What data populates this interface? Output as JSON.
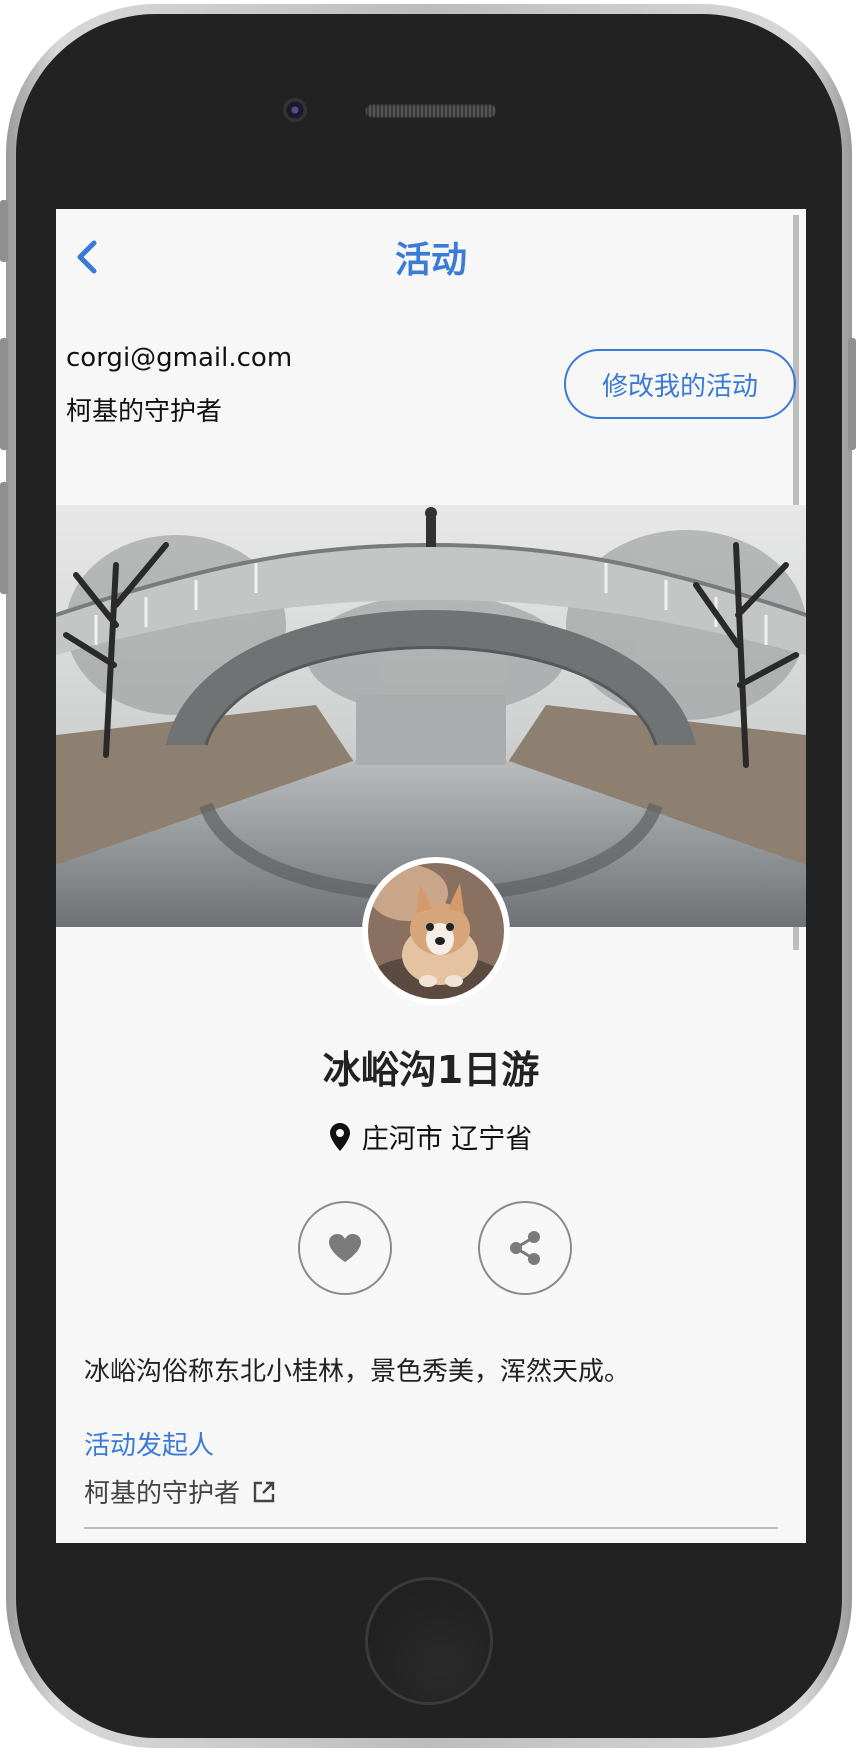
{
  "header": {
    "title": "活动",
    "back_icon": "chevron-left-icon"
  },
  "user": {
    "email": "corgi@gmail.com",
    "name": "柯基的守护者"
  },
  "edit_button": {
    "label": "修改我的活动"
  },
  "event": {
    "title": "冰峪沟1日游",
    "location": "庄河市 辽宁省",
    "location_icon": "map-pin-icon",
    "description": "冰峪沟俗称东北小桂林，景色秀美，浑然天成。"
  },
  "actions": {
    "like_icon": "heart-icon",
    "share_icon": "share-icon"
  },
  "organizer": {
    "label": "活动发起人",
    "name": "柯基的守护者",
    "link_icon": "external-link-icon"
  },
  "colors": {
    "accent": "#3a7bd5",
    "background": "#f7f7f7",
    "phone_body": "#222222"
  }
}
